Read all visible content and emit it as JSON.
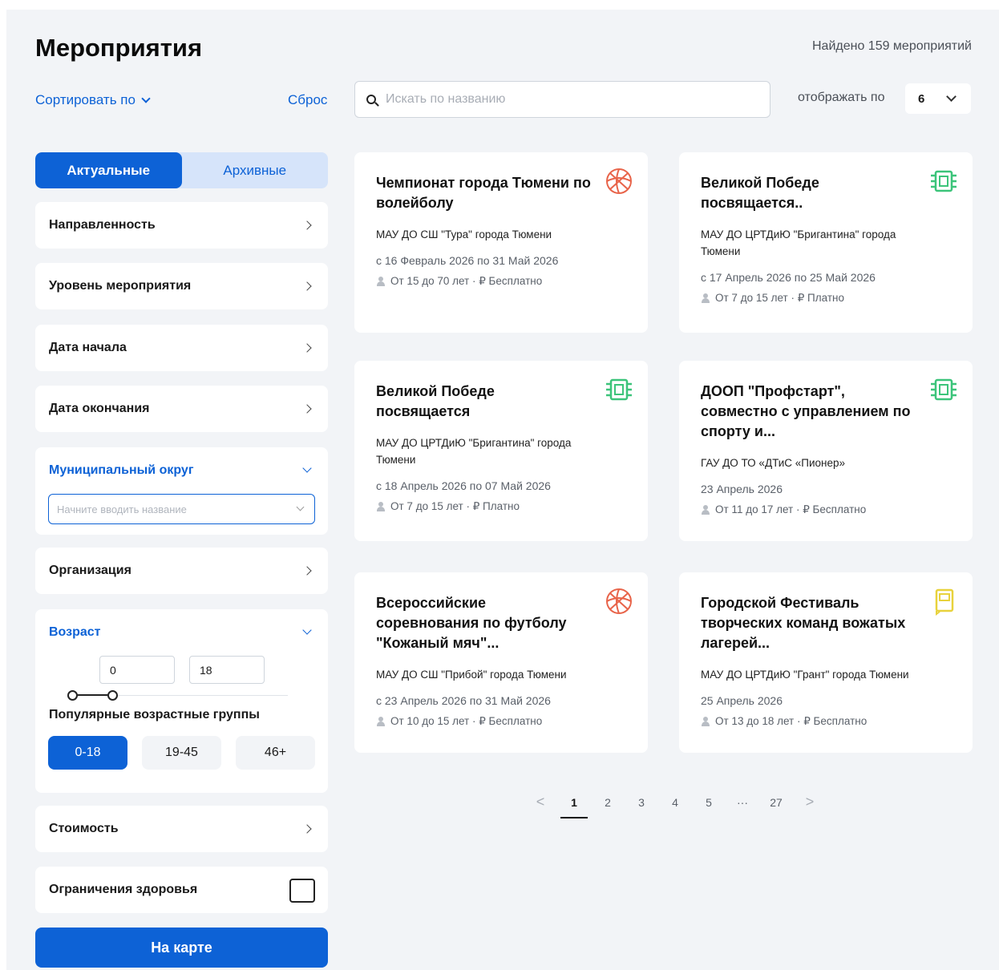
{
  "header": {
    "title": "Мероприятия",
    "found": "Найдено 159 мероприятий"
  },
  "controls": {
    "sort_label": "Сортировать по",
    "reset_label": "Сброс",
    "search_placeholder": "Искать по названию",
    "perpage_label": "отображать по",
    "perpage_value": "6"
  },
  "tabs": {
    "current": "Актуальные",
    "archive": "Архивные"
  },
  "filters": {
    "direction": "Направленность",
    "level": "Уровень мероприятия",
    "start_date": "Дата начала",
    "end_date": "Дата окончания",
    "municipal": "Муниципальный округ",
    "municipal_placeholder": "Начните вводить название",
    "organization": "Организация",
    "age": "Возраст",
    "age_min": "0",
    "age_max": "18",
    "popular_groups_label": "Популярные возрастные группы",
    "age_groups": [
      "0-18",
      "19-45",
      "46+"
    ],
    "age_group_selected": 0,
    "cost": "Стоимость",
    "health": "Ограничения здоровья",
    "map_button": "На карте"
  },
  "cards": [
    {
      "title": "Чемпионат города Тюмени по волейболу",
      "org": "МАУ ДО СШ \"Тура\" города Тюмени",
      "dates": "с 16 Февраль 2026 по 31 Май 2026",
      "meta": "От 15 до 70 лет · ₽ Бесплатно",
      "icon": "ball-icon"
    },
    {
      "title": "Великой Победе посвящается..",
      "org": "МАУ ДО ЦРТДиЮ \"Бригантина\" города Тюмени",
      "dates": "с 17 Апрель 2026 по 25 Май 2026",
      "meta": "От 7 до 15 лет · ₽ Платно",
      "icon": "chip-icon"
    },
    {
      "title": "Великой Победе посвящается",
      "org": "МАУ ДО ЦРТДиЮ \"Бригантина\" города Тюмени",
      "dates": "с 18 Апрель 2026 по 07 Май 2026",
      "meta": "От 7 до 15 лет · ₽ Платно",
      "icon": "chip-icon"
    },
    {
      "title": "ДООП \"Профстарт\", совместно с управлением по спорту и...",
      "org": "ГАУ ДО ТО «ДТиС «Пионер»",
      "dates": "23 Апрель 2026",
      "meta": "От 11 до 17 лет · ₽ Бесплатно",
      "icon": "chip-icon"
    },
    {
      "title": "Всероссийские соревнования по футболу \"Кожаный мяч\"...",
      "org": "МАУ ДО СШ \"Прибой\" города Тюмени",
      "dates": "с 23 Апрель 2026 по 31 Май 2026",
      "meta": "От 10 до 15 лет · ₽ Бесплатно",
      "icon": "ball-icon"
    },
    {
      "title": "Городской Фестиваль творческих команд вожатых лагерей...",
      "org": "МАУ ДО ЦРТДиЮ \"Грант\" города Тюмени",
      "dates": "25 Апрель 2026",
      "meta": "От 13 до 18 лет · ₽ Бесплатно",
      "icon": "book-icon"
    }
  ],
  "pagination": {
    "prev": "<",
    "pages": [
      "1",
      "2",
      "3",
      "4",
      "5",
      "···",
      "27"
    ],
    "current_index": 0,
    "next": ">"
  },
  "colors": {
    "accent": "#0d62d6",
    "sport_icon": "#e8644a",
    "tech_icon": "#3cc47a",
    "art_icon": "#e8d23c"
  }
}
